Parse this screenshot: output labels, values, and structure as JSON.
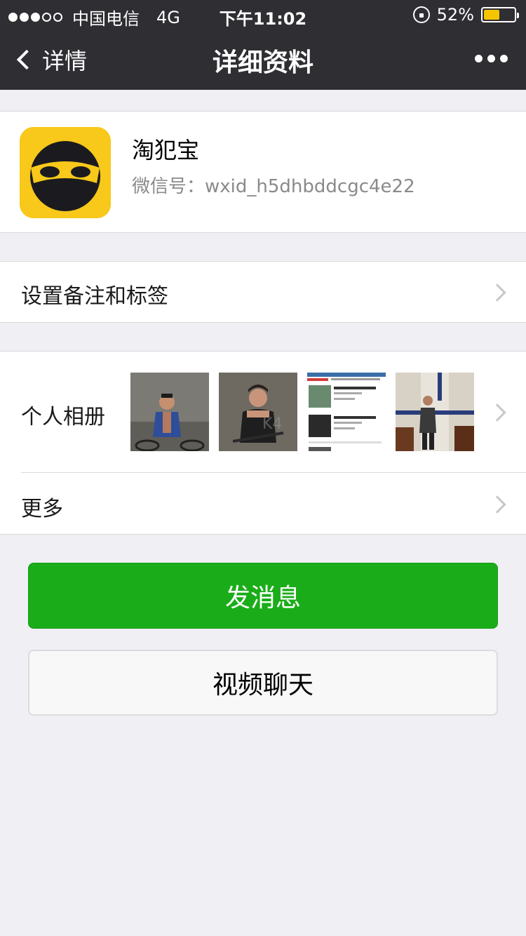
{
  "status_bar": {
    "carrier": "中国电信",
    "network": "4G",
    "time": "下午11:02",
    "battery_percent": "52%",
    "battery_level": 0.52,
    "signal_bars_filled": 3,
    "signal_bars_total": 5
  },
  "nav": {
    "back_label": "详情",
    "title": "详细资料"
  },
  "profile": {
    "nickname": "淘犯宝",
    "wxid": "微信号：wxid_h5dhbddcgc4e22"
  },
  "rows": {
    "remark_label": "设置备注和标签",
    "album_label": "个人相册",
    "more_label": "更多"
  },
  "album_thumbnails": [
    "photo-man-on-bike",
    "photo-woman-on-bike",
    "photo-news-screenshot",
    "photo-woman-standing"
  ],
  "buttons": {
    "send_message": "发消息",
    "video_call": "视频聊天"
  },
  "colors": {
    "nav_bg": "#2e2e33",
    "primary_green": "#1aad19",
    "avatar_yellow": "#f8c81a",
    "battery_yellow": "#f5c400"
  }
}
